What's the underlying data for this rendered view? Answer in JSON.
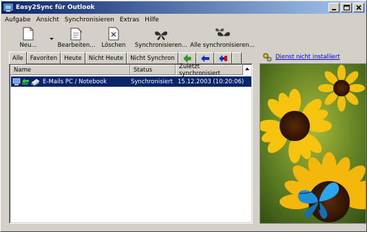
{
  "window": {
    "title": "Easy2Sync für Outlook",
    "controls": {
      "minimize": "_",
      "maximize": "□",
      "close": "×"
    }
  },
  "menu": [
    "Aufgabe",
    "Ansicht",
    "Synchronisieren",
    "Extras",
    "Hilfe"
  ],
  "toolbar": {
    "new_label": "Neu...",
    "edit_label": "Bearbeiten...",
    "delete_label": "Löschen",
    "sync_label": "Synchronisieren...",
    "sync_all_label": "Alle synchronisieren..."
  },
  "tabs": [
    "Alle",
    "Favoriten",
    "Heute",
    "Nicht Heute",
    "Nicht Synchron"
  ],
  "table": {
    "columns": [
      "Name",
      "Status",
      "Zuletzt synchronisiert"
    ],
    "rows": [
      {
        "name": "E-Mails PC / Notebook",
        "status": "Synchronisiert",
        "last_sync": "15.12.2003 (10:20:06)"
      }
    ]
  },
  "sidebar": {
    "service_link": "Dienst nicht installiert"
  },
  "colors": {
    "titlebar_start": "#0a246a",
    "titlebar_end": "#a6caf0",
    "selection": "#0a246a",
    "link": "#0000ee"
  }
}
